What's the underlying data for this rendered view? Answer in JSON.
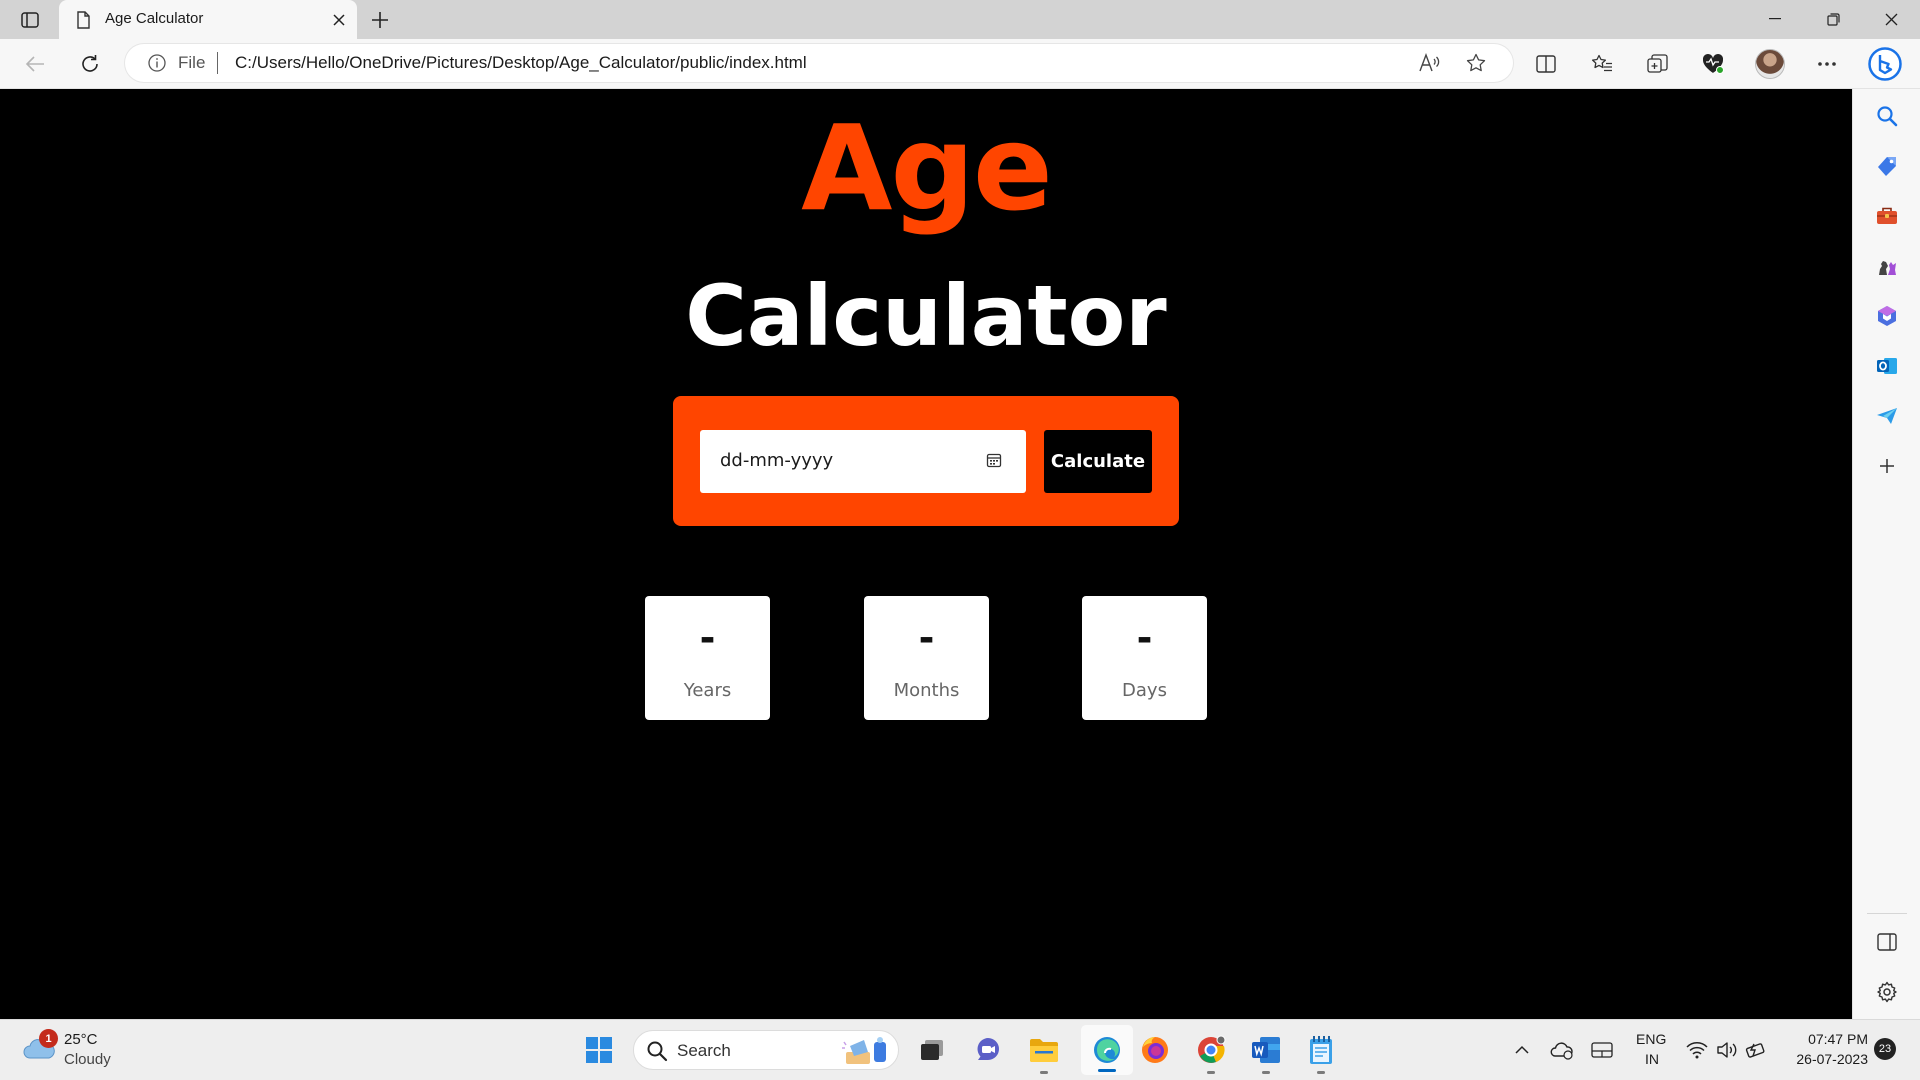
{
  "browser": {
    "tab_title": "Age Calculator",
    "address_scheme": "File",
    "url": "C:/Users/Hello/OneDrive/Pictures/Desktop/Age_Calculator/public/index.html"
  },
  "page": {
    "heading_primary": "Age",
    "heading_secondary": "Calculator",
    "date_placeholder": "dd-mm-yyyy",
    "calculate_label": "Calculate",
    "results": [
      {
        "value": "-",
        "label": "Years"
      },
      {
        "value": "-",
        "label": "Months"
      },
      {
        "value": "-",
        "label": "Days"
      }
    ],
    "colors": {
      "accent": "#ff4500",
      "background": "#000000",
      "card": "#ffffff"
    }
  },
  "taskbar": {
    "weather_temp": "25°C",
    "weather_condition": "Cloudy",
    "weather_badge": "1",
    "search_label": "Search",
    "lang_top": "ENG",
    "lang_bottom": "IN",
    "time": "07:47 PM",
    "date": "26-07-2023",
    "notification_count": "23"
  },
  "icons": {
    "sidebar": [
      "search-icon",
      "shopping-tag-icon",
      "tools-briefcase-icon",
      "games-chess-icon",
      "microsoft365-icon",
      "outlook-icon",
      "drop-send-icon",
      "add-icon",
      "sidebar-toggle-icon",
      "settings-gear-icon"
    ],
    "taskbar_apps": [
      "windows-start-icon",
      "task-view-icon",
      "teams-chat-icon",
      "file-explorer-icon",
      "edge-icon",
      "firefox-icon",
      "chrome-icon",
      "word-icon",
      "notepad-icon"
    ]
  }
}
